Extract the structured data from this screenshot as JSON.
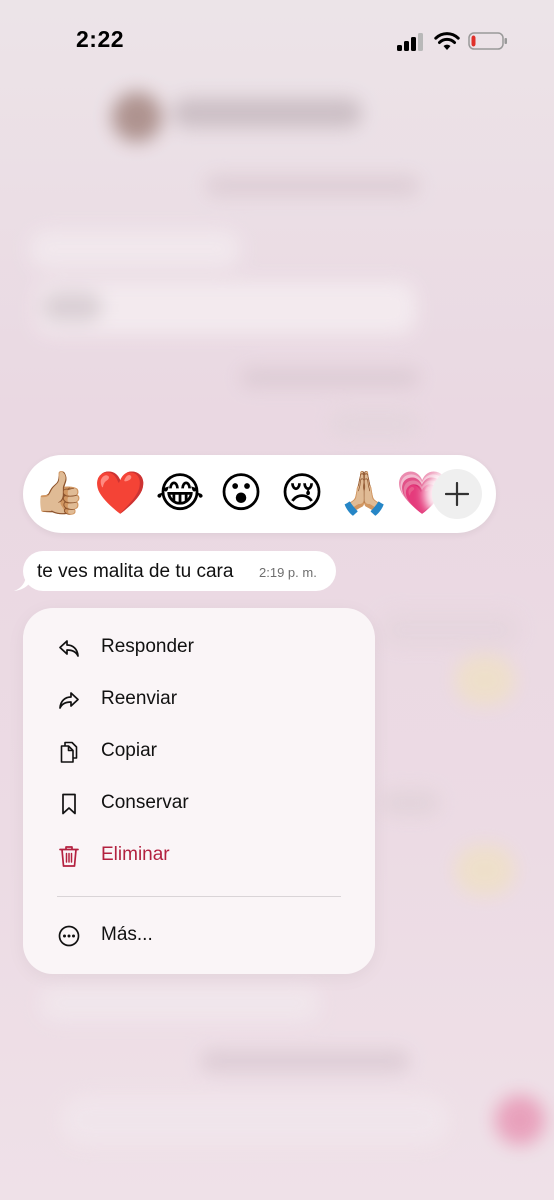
{
  "status_bar": {
    "time": "2:22",
    "signal_bars": 3,
    "battery_level": 0.12
  },
  "reactions": {
    "emojis": [
      "👍🏼",
      "❤️",
      "😂",
      "😮",
      "😢",
      "🙏🏼",
      "💗"
    ],
    "more_icon": "plus-icon"
  },
  "message": {
    "text": "te ves malita de tu cara",
    "time": "2:19 p. m."
  },
  "context_menu": {
    "items": [
      {
        "label": "Responder",
        "icon": "reply-icon"
      },
      {
        "label": "Reenviar",
        "icon": "forward-icon"
      },
      {
        "label": "Copiar",
        "icon": "copy-icon"
      },
      {
        "label": "Conservar",
        "icon": "bookmark-icon"
      },
      {
        "label": "Eliminar",
        "icon": "trash-icon"
      }
    ],
    "more": {
      "label": "Más...",
      "icon": "more-icon"
    }
  },
  "colors": {
    "danger": "#b3213f",
    "battery_low": "#e0302a"
  }
}
